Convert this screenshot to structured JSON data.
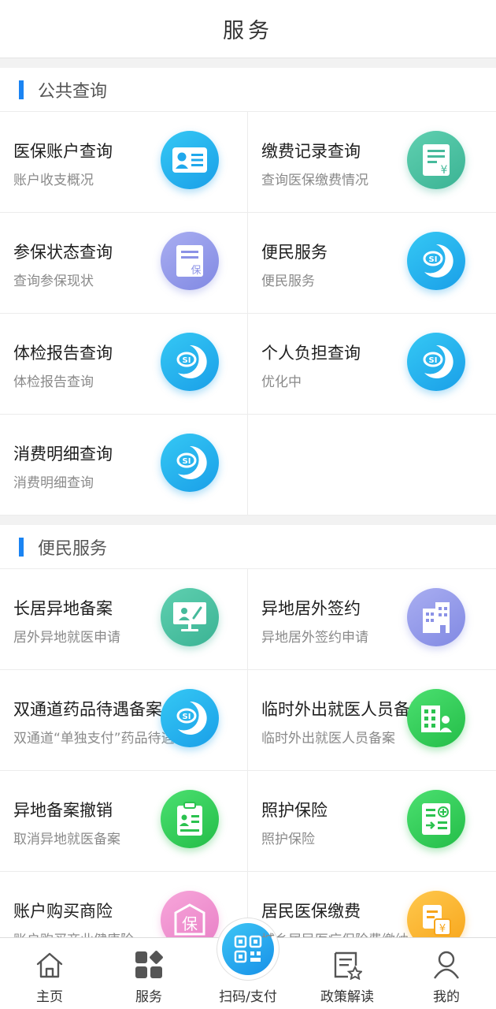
{
  "header": {
    "title": "服务"
  },
  "sections": [
    {
      "title": "公共查询",
      "items": [
        {
          "title": "医保账户查询",
          "subtitle": "账户收支概况",
          "icon": "id-card-icon",
          "color": "#1fa8ec"
        },
        {
          "title": "缴费记录查询",
          "subtitle": "查询医保缴费情况",
          "icon": "receipt-yuan-icon",
          "color": "#46ba9b"
        },
        {
          "title": "参保状态查询",
          "subtitle": "查询参保现状",
          "icon": "insurance-document-icon",
          "color": "#8b92e6"
        },
        {
          "title": "便民服务",
          "subtitle": "便民服务",
          "icon": "si-logo-icon",
          "color": "#1fa8ec"
        },
        {
          "title": "体检报告查询",
          "subtitle": "体检报告查询",
          "icon": "si-logo-icon",
          "color": "#1fa8ec"
        },
        {
          "title": "个人负担查询",
          "subtitle": "优化中",
          "icon": "si-logo-icon",
          "color": "#1fa8ec"
        },
        {
          "title": "消费明细查询",
          "subtitle": "消费明细查询",
          "icon": "si-logo-icon",
          "color": "#1fa8ec"
        }
      ]
    },
    {
      "title": "便民服务",
      "items": [
        {
          "title": "长居异地备案",
          "subtitle": "居外异地就医申请",
          "icon": "presentation-board-icon",
          "color": "#46ba9b"
        },
        {
          "title": "异地居外签约",
          "subtitle": "异地居外签约申请",
          "icon": "building-icon",
          "color": "#8b92e6"
        },
        {
          "title": "双通道药品待遇备案",
          "subtitle": "双通道“单独支付”药品待遇备案",
          "icon": "si-logo-icon",
          "color": "#1fa8ec"
        },
        {
          "title": "临时外出就医人员备案",
          "subtitle": "临时外出就医人员备案",
          "icon": "grid-person-icon",
          "color": "#2bc24f"
        },
        {
          "title": "异地备案撤销",
          "subtitle": "取消异地就医备案",
          "icon": "clipboard-person-icon",
          "color": "#2bc24f"
        },
        {
          "title": "照护保险",
          "subtitle": "照护保险",
          "icon": "care-document-icon",
          "color": "#2bc24f"
        },
        {
          "title": "账户购买商险",
          "subtitle": "账户购买商业健康险",
          "icon": "bao-badge-icon",
          "color": "#ea86c9"
        },
        {
          "title": "居民医保缴费",
          "subtitle": "城乡居民医疗保险费缴纳",
          "icon": "payment-yuan-icon",
          "color": "#f7a51b"
        }
      ]
    }
  ],
  "glyphs": {
    "insurance": "保",
    "yuan": "¥"
  },
  "tabbar": [
    {
      "label": "主页",
      "icon": "home-icon"
    },
    {
      "label": "服务",
      "icon": "grid-apps-icon"
    },
    {
      "label": "扫码/支付",
      "icon": "qr-code-icon"
    },
    {
      "label": "政策解读",
      "icon": "policy-star-icon"
    },
    {
      "label": "我的",
      "icon": "user-icon"
    }
  ]
}
